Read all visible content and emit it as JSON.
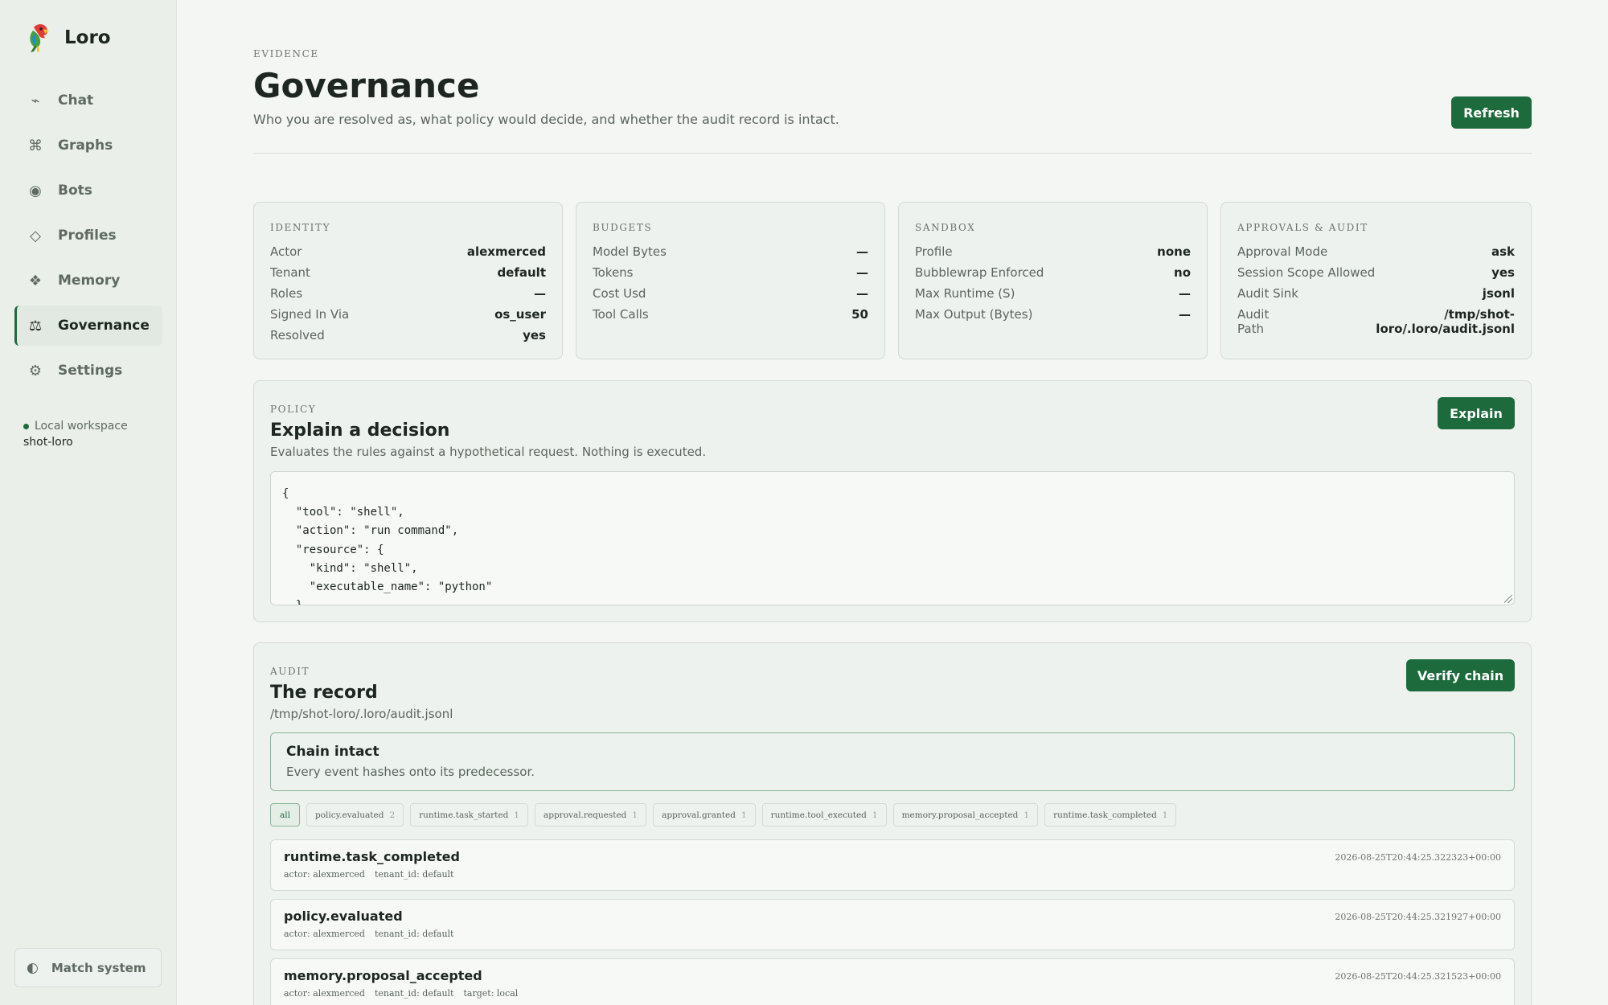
{
  "app": {
    "name": "Loro",
    "logo_icon": "parrot-icon"
  },
  "nav": [
    {
      "label": "Chat",
      "glyph": "⌁",
      "icon": "chat-icon"
    },
    {
      "label": "Graphs",
      "glyph": "⌘",
      "icon": "graphs-icon"
    },
    {
      "label": "Bots",
      "glyph": "◉",
      "icon": "bots-icon"
    },
    {
      "label": "Profiles",
      "glyph": "◇",
      "icon": "profiles-icon"
    },
    {
      "label": "Memory",
      "glyph": "❖",
      "icon": "memory-icon"
    },
    {
      "label": "Governance",
      "glyph": "⚖",
      "icon": "governance-icon",
      "active": true
    },
    {
      "label": "Settings",
      "glyph": "⚙",
      "icon": "settings-icon"
    }
  ],
  "workspace": {
    "label": "Local workspace",
    "name": "shot-loro"
  },
  "theme": {
    "label": "Match system",
    "glyph": "◐"
  },
  "header": {
    "eyebrow": "EVIDENCE",
    "title": "Governance",
    "subtitle": "Who you are resolved as, what policy would decide, and whether the audit record is intact.",
    "refresh_label": "Refresh"
  },
  "cards": {
    "identity": {
      "eyebrow": "IDENTITY",
      "rows": [
        {
          "k": "Actor",
          "v": "alexmerced"
        },
        {
          "k": "Tenant",
          "v": "default"
        },
        {
          "k": "Roles",
          "v": "—"
        },
        {
          "k": "Signed In Via",
          "v": "os_user"
        },
        {
          "k": "Resolved",
          "v": "yes"
        }
      ]
    },
    "budgets": {
      "eyebrow": "BUDGETS",
      "rows": [
        {
          "k": "Model Bytes",
          "v": "—"
        },
        {
          "k": "Tokens",
          "v": "—"
        },
        {
          "k": "Cost Usd",
          "v": "—"
        },
        {
          "k": "Tool Calls",
          "v": "50"
        }
      ]
    },
    "sandbox": {
      "eyebrow": "SANDBOX",
      "rows": [
        {
          "k": "Profile",
          "v": "none"
        },
        {
          "k": "Bubblewrap Enforced",
          "v": "no"
        },
        {
          "k": "Max Runtime (S)",
          "v": "—"
        },
        {
          "k": "Max Output (Bytes)",
          "v": "—"
        }
      ]
    },
    "approvals": {
      "eyebrow": "APPROVALS & AUDIT",
      "rows": [
        {
          "k": "Approval Mode",
          "v": "ask"
        },
        {
          "k": "Session Scope Allowed",
          "v": "yes"
        },
        {
          "k": "Audit Sink",
          "v": "jsonl"
        },
        {
          "k": "Audit Path",
          "v": "/tmp/shot-loro/.loro/audit.jsonl"
        }
      ]
    }
  },
  "policy": {
    "eyebrow": "POLICY",
    "title": "Explain a decision",
    "subtitle": "Evaluates the rules against a hypothetical request. Nothing is executed.",
    "button_label": "Explain",
    "request_json": "{\n  \"tool\": \"shell\",\n  \"action\": \"run command\",\n  \"resource\": {\n    \"kind\": \"shell\",\n    \"executable_name\": \"python\"\n  }\n}"
  },
  "audit": {
    "eyebrow": "AUDIT",
    "title": "The record",
    "path": "/tmp/shot-loro/.loro/audit.jsonl",
    "button_label": "Verify chain",
    "chain": {
      "title": "Chain intact",
      "subtitle": "Every event hashes onto its predecessor."
    },
    "filters": [
      {
        "label": "all",
        "count": "",
        "active": true
      },
      {
        "label": "policy.evaluated",
        "count": "2"
      },
      {
        "label": "runtime.task_started",
        "count": "1"
      },
      {
        "label": "approval.requested",
        "count": "1"
      },
      {
        "label": "approval.granted",
        "count": "1"
      },
      {
        "label": "runtime.tool_executed",
        "count": "1"
      },
      {
        "label": "memory.proposal_accepted",
        "count": "1"
      },
      {
        "label": "runtime.task_completed",
        "count": "1"
      }
    ],
    "events": [
      {
        "name": "runtime.task_completed",
        "timestamp": "2026-08-25T20:44:25.322323+00:00",
        "meta": [
          "actor: alexmerced",
          "tenant_id: default"
        ]
      },
      {
        "name": "policy.evaluated",
        "timestamp": "2026-08-25T20:44:25.321927+00:00",
        "meta": [
          "actor: alexmerced",
          "tenant_id: default"
        ]
      },
      {
        "name": "memory.proposal_accepted",
        "timestamp": "2026-08-25T20:44:25.321523+00:00",
        "meta": [
          "actor: alexmerced",
          "tenant_id: default",
          "target: local"
        ]
      }
    ]
  }
}
